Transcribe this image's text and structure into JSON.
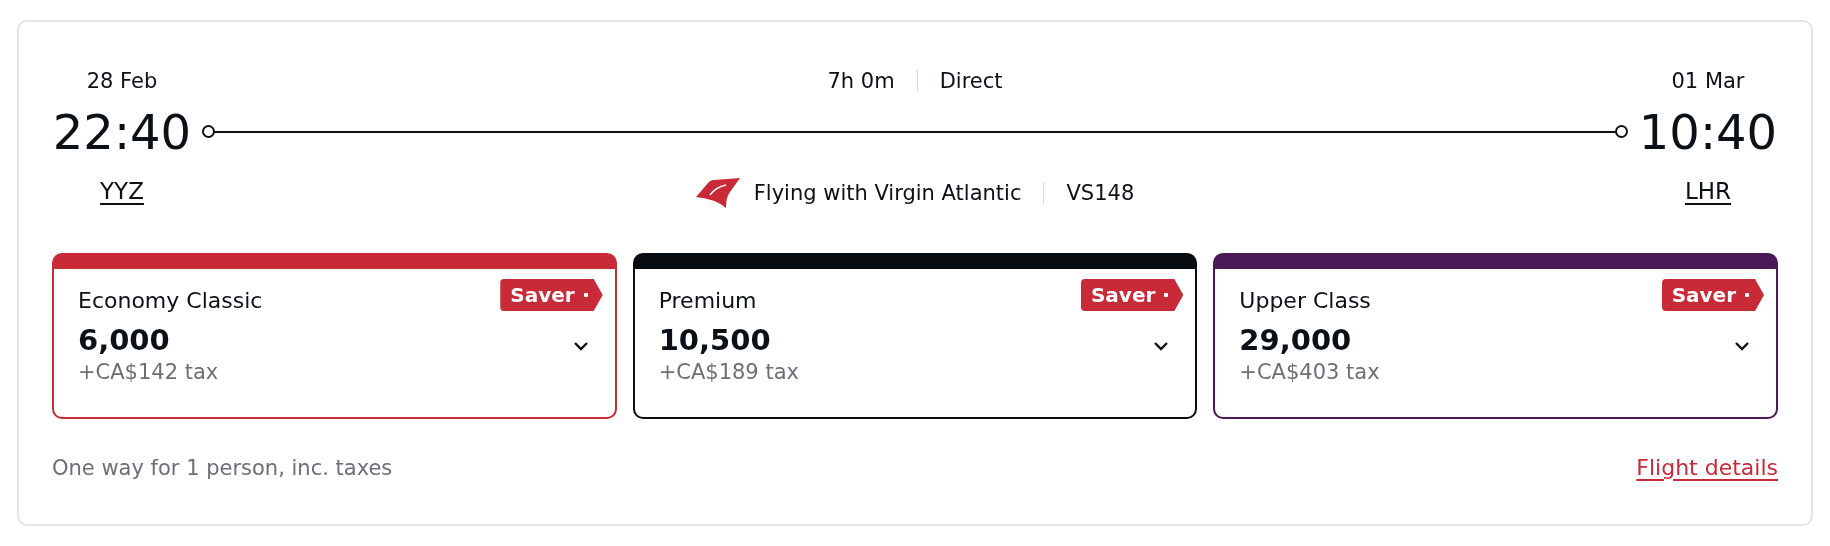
{
  "departure": {
    "date": "28 Feb",
    "time": "22:40",
    "airport": "YYZ"
  },
  "journey": {
    "duration": "7h 0m",
    "stops": "Direct",
    "operator": "Flying with Virgin Atlantic",
    "flight_number": "VS148"
  },
  "arrival": {
    "date": "01 Mar",
    "time": "10:40",
    "airport": "LHR"
  },
  "fares": [
    {
      "cabin": "Economy Classic",
      "badge": "Saver",
      "points": "6,000",
      "tax": "+CA$142 tax",
      "color": "#c82a37"
    },
    {
      "cabin": "Premium",
      "badge": "Saver",
      "points": "10,500",
      "tax": "+CA$189 tax",
      "color": "#080d12"
    },
    {
      "cabin": "Upper Class",
      "badge": "Saver",
      "points": "29,000",
      "tax": "+CA$403 tax",
      "color": "#4a1a56"
    }
  ],
  "footer": {
    "note": "One way for 1 person, inc. taxes",
    "link": "Flight details"
  }
}
